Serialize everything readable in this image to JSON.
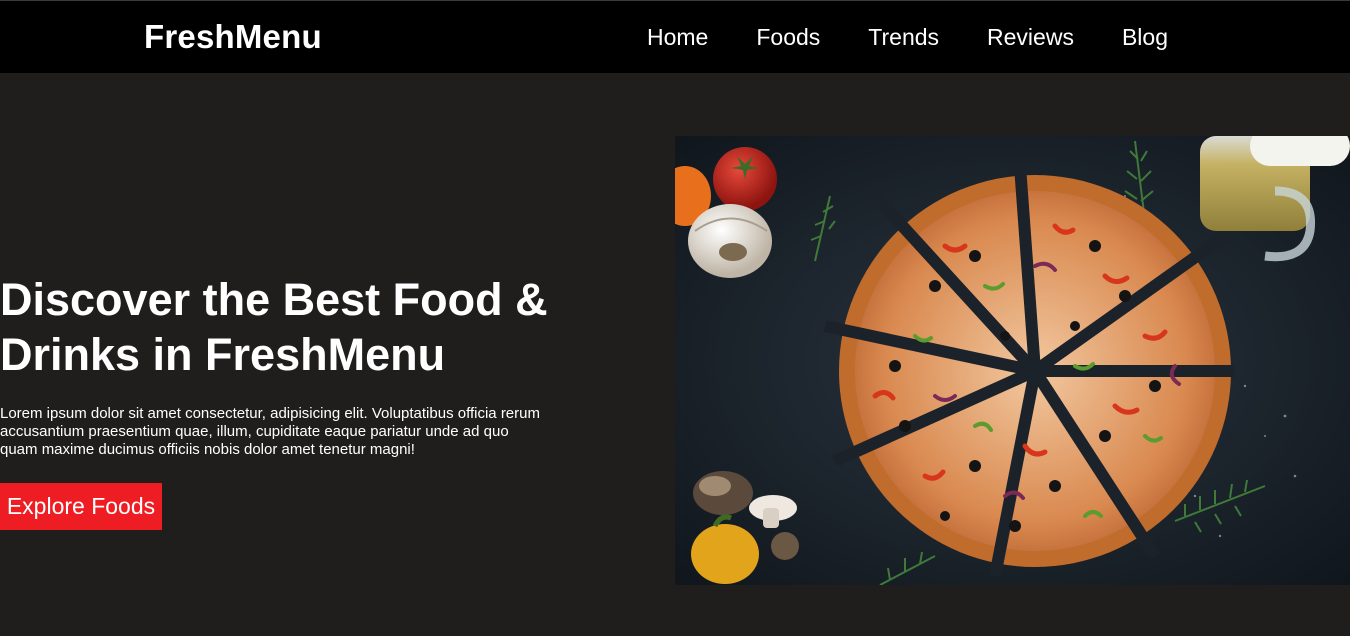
{
  "header": {
    "brand": "FreshMenu",
    "nav": [
      "Home",
      "Foods",
      "Trends",
      "Reviews",
      "Blog"
    ]
  },
  "hero": {
    "title": "Discover the Best Food & Drinks in FreshMenu",
    "description": "Lorem ipsum dolor sit amet consectetur, adipisicing elit. Voluptatibus officia rerum accusantium praesentium quae, illum, cupiditate eaque pariatur unde ad quo quam maxime ducimus officiis nobis dolor amet tenetur magni!",
    "cta_label": "Explore Foods",
    "image_subject": "pizza-on-dark-table"
  },
  "colors": {
    "nav_bg": "#000000",
    "page_bg": "#201d1d",
    "accent": "#ee1d23",
    "text": "#ffffff"
  }
}
